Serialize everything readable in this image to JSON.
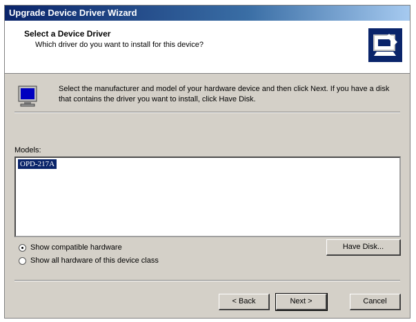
{
  "window": {
    "title": "Upgrade Device Driver Wizard"
  },
  "header": {
    "title": "Select a Device Driver",
    "subtitle": "Which driver do you want to install for this device?"
  },
  "intro": "Select the manufacturer and model of your hardware device and then click Next. If you have a disk that contains the driver you want to install, click Have Disk.",
  "models": {
    "label": "Models:",
    "items": [
      "OPD-217A"
    ],
    "selected": "OPD-217A"
  },
  "options": {
    "show_compatible": "Show compatible hardware",
    "show_all": "Show all hardware of this device class",
    "selected": "show_compatible"
  },
  "buttons": {
    "have_disk": "Have Disk...",
    "back": "< Back",
    "next": "Next >",
    "cancel": "Cancel"
  },
  "icons": {
    "wizard": "wizard-icon",
    "monitor": "monitor-icon"
  }
}
